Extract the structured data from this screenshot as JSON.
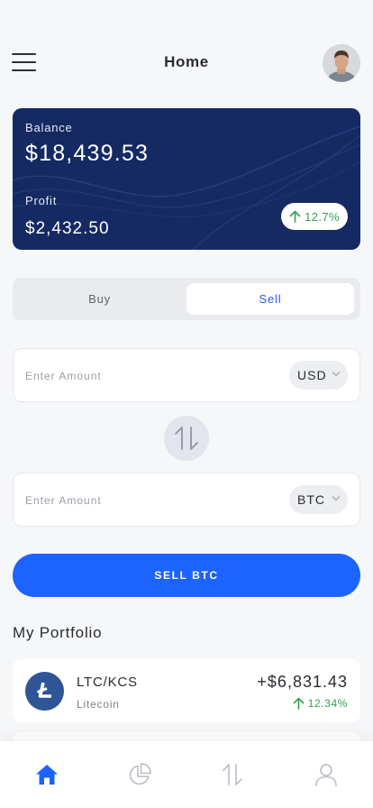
{
  "header": {
    "title": "Home"
  },
  "balance_card": {
    "balance_label": "Balance",
    "balance_value": "$18,439.53",
    "profit_label": "Profit",
    "profit_value": "$2,432.50",
    "profit_change": "12.7%",
    "trend": "up"
  },
  "trade_toggle": {
    "options": [
      "Buy",
      "Sell"
    ],
    "selected": "Sell"
  },
  "from_amount": {
    "value": "",
    "placeholder": "Enter Amount",
    "currency": "USD"
  },
  "to_amount": {
    "value": "",
    "placeholder": "Enter Amount",
    "currency": "BTC"
  },
  "cta": {
    "label": "SELL BTC"
  },
  "portfolio": {
    "title": "My Portfolio",
    "items": [
      {
        "pair": "LTC/KCS",
        "name": "Litecoin",
        "value": "+$6,831.43",
        "change": "12.34%",
        "trend": "up",
        "icon": "litecoin-icon"
      }
    ]
  },
  "tabbar": {
    "tabs": [
      {
        "icon": "home-icon",
        "active": true
      },
      {
        "icon": "pie-chart-icon",
        "active": false
      },
      {
        "icon": "swap-icon",
        "active": false
      },
      {
        "icon": "profile-icon",
        "active": false
      }
    ]
  },
  "colors": {
    "primary": "#1c63ff",
    "card": "#152a63",
    "positive": "#2ea44f",
    "background": "#f6f7f9"
  }
}
